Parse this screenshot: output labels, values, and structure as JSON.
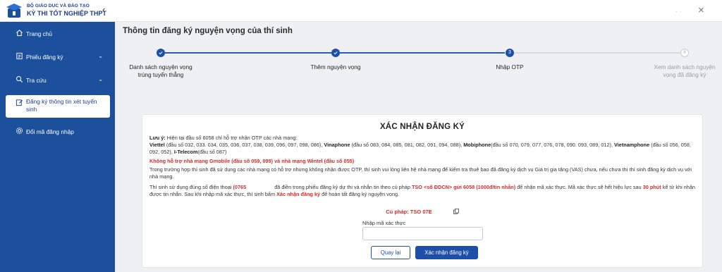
{
  "header": {
    "org": "BỘ GIÁO DỤC VÀ ĐÀO TẠO",
    "title": "KỲ THI TỐT NGHIỆP THPT",
    "collapse_icon": "chevron-left-icon",
    "close_icon": "close-icon"
  },
  "sidebar": {
    "items": [
      {
        "label": "Trang chủ",
        "icon": "home-icon"
      },
      {
        "label": "Phiếu đăng ký",
        "icon": "form-icon",
        "has_submenu": true
      },
      {
        "label": "Tra cứu",
        "icon": "search-icon",
        "has_submenu": true
      },
      {
        "label": "Đăng ký thông tin xét tuyển sinh",
        "icon": "edit-icon",
        "active": true
      },
      {
        "label": "Đổi mã đăng nhập",
        "icon": "gear-icon"
      }
    ]
  },
  "page": {
    "title": "Thông tin đăng ký nguyện vọng của thí sinh"
  },
  "stepper": {
    "steps": [
      {
        "number": "1",
        "label": "Danh sách nguyện vọng trúng tuyển thẳng",
        "status": "done"
      },
      {
        "number": "2",
        "label": "Thêm nguyện vọng",
        "status": "done"
      },
      {
        "number": "3",
        "label": "Nhập OTP",
        "status": "current"
      },
      {
        "number": "4",
        "label": "Xem danh sách nguyện vọng đã đăng ký",
        "status": "pending"
      }
    ]
  },
  "confirm": {
    "title": "XÁC NHẬN ĐĂNG KÝ",
    "note_label": "Lưu ý:",
    "note_text": "Hiện tại đầu số 6058 chỉ hỗ trợ nhận OTP các nhà mạng:",
    "carriers": [
      {
        "name": "Viettel",
        "prefixes": "(đầu số 032, 033. 034, 035, 036, 037, 038, 039, 096, 097, 098, 086),"
      },
      {
        "name": "Vinaphone",
        "prefixes": "(đầu số 083, 084, 085, 081, 082, 091, 094, 088),"
      },
      {
        "name": "Mobiphone",
        "prefixes": "(đầu số 070, 079, 077, 076, 078, 090. 093, 089, 012),"
      },
      {
        "name": "Vietnamphone",
        "prefixes": "(đầu số 056, 058, 092, 052),"
      },
      {
        "name": "I-Telecom",
        "prefixes": "(đầu số 087)"
      }
    ],
    "unsupported": "Không hỗ trợ nhà mạng Gmobile (đầu số 059, 099) và nhà mạng Wintel (đầu số 055)",
    "support_note": "Trong trường hợp thí sinh đã sử dụng các nhà mạng có hỗ trợ nhưng không nhận được OTP, thí sinh vui lòng liên hệ nhà mạng để kiểm tra thuê bao đã đăng ký dịch vụ Giá trị gia tăng (VAS) chưa, nếu chưa thì thí sinh đăng ký dịch vụ với nhà mạng.",
    "phone_intro": "Thí sinh sử dụng đúng số điện thoại",
    "phone_value": "(0765",
    "phone_mid": "đã điền trong phiếu đăng ký dự thi và nhắn tin theo cú pháp",
    "sms_syntax": "TSO <số ĐDCN> gửi 6058 (1000đ/tin nhắn)",
    "phone_after": "để nhận mã xác thực. Mã xác thực sẽ hết hiệu lực sau",
    "expiry": "30 phút",
    "expiry_after": "kể từ khi nhận được tin nhắn. Sau khi nhập mã xác thực, thí sinh bấm",
    "confirm_ref": "Xác nhận đăng ký",
    "closing": "để hoàn tất đăng ký nguyện vọng.",
    "syntax_label": "Cú pháp: TSO 07E",
    "copy_icon": "copy-icon",
    "otp_label": "Nhập mã xác thực",
    "otp_placeholder": "",
    "back_button": "Quay lại",
    "confirm_button": "Xác nhận đăng ký"
  },
  "colors": {
    "sidebar_bg": "#1c4f9c",
    "primary": "#1e4fa8",
    "warning_red": "#d12c2c"
  }
}
